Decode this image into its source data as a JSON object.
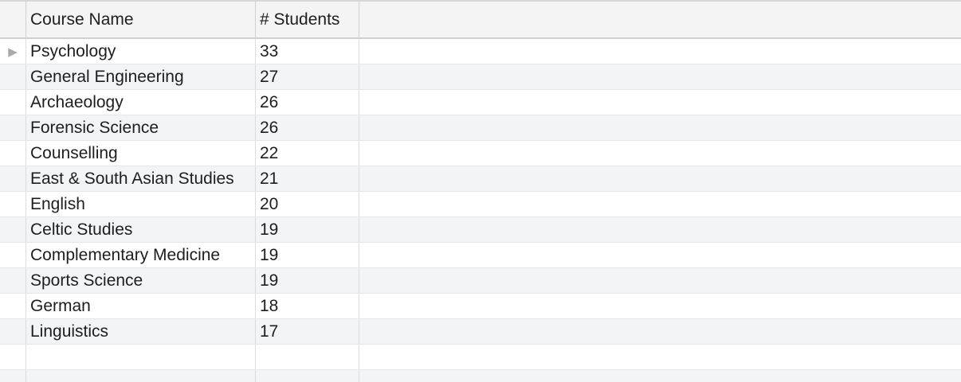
{
  "table": {
    "columns": [
      "Course Name",
      "# Students"
    ],
    "rows": [
      {
        "course": "Psychology",
        "students": "33"
      },
      {
        "course": "General Engineering",
        "students": "27"
      },
      {
        "course": "Archaeology",
        "students": "26"
      },
      {
        "course": "Forensic Science",
        "students": "26"
      },
      {
        "course": "Counselling",
        "students": "22"
      },
      {
        "course": "East & South Asian Studies",
        "students": "21"
      },
      {
        "course": "English",
        "students": "20"
      },
      {
        "course": "Celtic Studies",
        "students": "19"
      },
      {
        "course": "Complementary Medicine",
        "students": "19"
      },
      {
        "course": "Sports Science",
        "students": "19"
      },
      {
        "course": "German",
        "students": "18"
      },
      {
        "course": "Linguistics",
        "students": "17"
      }
    ],
    "current_row_indicator": "▶",
    "selected_row_index": 0
  },
  "icons": {
    "current_row": "play-right-triangle-icon"
  },
  "colors": {
    "header_bg": "#f4f4f4",
    "alt_row_bg": "#f3f4f5",
    "grid_line": "#dcdcdc",
    "indicator": "#a9a9a9"
  }
}
